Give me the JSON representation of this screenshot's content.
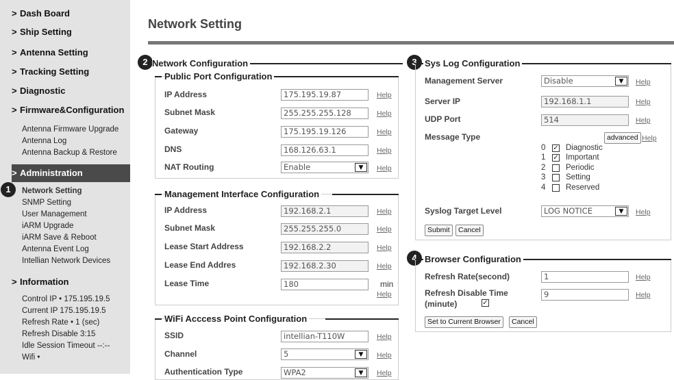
{
  "sidebar": {
    "headings": [
      "Dash Board",
      "Ship Setting",
      "Antenna Setting",
      "Tracking Setting",
      "Diagnostic",
      "Firmware&Configuration"
    ],
    "firmware_items": [
      "Antenna Firmware Upgrade",
      "Antenna Log",
      "Antenna Backup & Restore"
    ],
    "administration": "Administration",
    "admin_items": [
      "Network Setting",
      "SNMP Setting",
      "User Management",
      "iARM Upgrade",
      "iARM Save & Reboot",
      "Antenna Event Log",
      "Intellian Network Devices"
    ],
    "information": "Information",
    "info_lines": [
      "Control IP • 175.195.19.5",
      "Current IP  175.195.19.5",
      "Refresh Rate •    1 (sec)",
      "Refresh Disable  3:15",
      "Idle Session Timeout  --:--",
      "Wifi  •"
    ],
    "chevron": ">"
  },
  "markers": [
    "1",
    "2",
    "3",
    "4"
  ],
  "page_title": "Network Setting",
  "help_label": "Help",
  "network_config": {
    "title": "Network Configuration",
    "public_port": {
      "title": "Public Port Configuration",
      "rows": [
        {
          "label": "IP Address",
          "value": "175.195.19.87"
        },
        {
          "label": "Subnet Mask",
          "value": "255.255.255.128"
        },
        {
          "label": "Gateway",
          "value": "175.195.19.126"
        },
        {
          "label": "DNS",
          "value": "168.126.63.1"
        },
        {
          "label": "NAT Routing",
          "value": "Enable"
        }
      ]
    },
    "management": {
      "title": "Management Interface Configuration",
      "rows": [
        {
          "label": "IP Address",
          "value": "192.168.2.1"
        },
        {
          "label": "Subnet Mask",
          "value": "255.255.255.0"
        },
        {
          "label": "Lease Start Address",
          "value": "192.168.2.2"
        },
        {
          "label": "Lease End Addres",
          "value": "192.168.2.30"
        },
        {
          "label": "Lease Time",
          "value": "180"
        }
      ],
      "lease_unit": "min"
    },
    "wifi": {
      "title": "WiFi Acccess Point Configuration",
      "rows": [
        {
          "label": "SSID",
          "value": "intellian-T110W"
        },
        {
          "label": "Channel",
          "value": "5"
        },
        {
          "label": "Authentication Type",
          "value": "WPA2"
        }
      ]
    }
  },
  "syslog": {
    "title": "Sys Log Configuration",
    "management_server": {
      "label": "Management Server",
      "value": "Disable"
    },
    "server_ip": {
      "label": "Server IP",
      "value": "192.168.1.1"
    },
    "udp_port": {
      "label": "UDP Port",
      "value": "514"
    },
    "message_type": {
      "label": "Message Type",
      "advanced": "advanced",
      "options": [
        {
          "num": "0",
          "name": "Diagnostic",
          "checked": true
        },
        {
          "num": "1",
          "name": "Important",
          "checked": true
        },
        {
          "num": "2",
          "name": "Periodic",
          "checked": false
        },
        {
          "num": "3",
          "name": "Setting",
          "checked": false
        },
        {
          "num": "4",
          "name": "Reserved",
          "checked": false
        }
      ]
    },
    "target_level": {
      "label": "Syslog Target Level",
      "value": "LOG NOTICE"
    },
    "submit": "Submit",
    "cancel": "Cancel"
  },
  "browser": {
    "title": "Browser Configuration",
    "refresh_rate": {
      "label": "Refresh Rate(second)",
      "value": "1"
    },
    "refresh_disable": {
      "label_line1": "Refresh Disable Time",
      "label_line2": "(minute)",
      "value": "9",
      "checked": true
    },
    "set_current": "Set to Current Browser",
    "cancel": "Cancel"
  },
  "colors": {
    "sidebar_bg": "#e3e3e3",
    "active_bg": "#4a4a4a",
    "rule": "#777777"
  }
}
